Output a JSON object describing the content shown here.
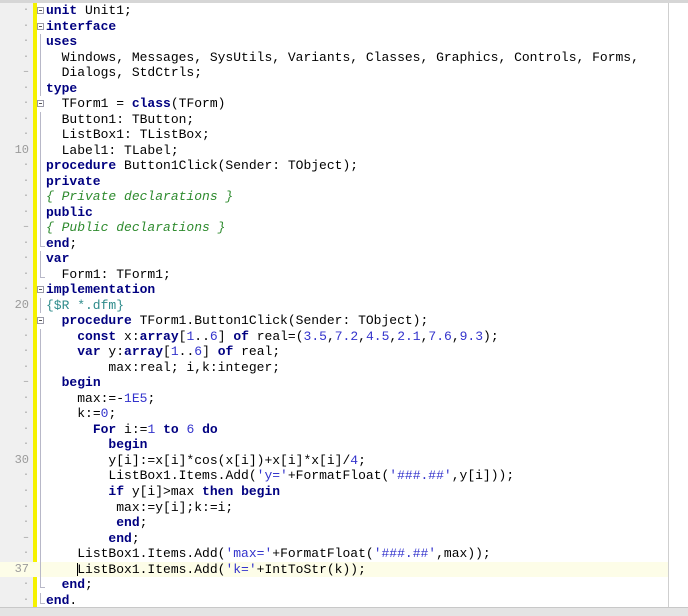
{
  "editor": {
    "colors": {
      "keyword": "#000080",
      "literal": "#3333cc",
      "comment": "#2e8b2e",
      "directive": "#2e8b8b",
      "modified_bar": "#f5f200",
      "current_line": "#fdfde8"
    },
    "current_line": 37,
    "lines": [
      {
        "num": "·",
        "fold": "start",
        "indent": "",
        "tokens": [
          {
            "t": "k",
            "v": "unit"
          },
          {
            "t": "p",
            "v": " Unit1;"
          }
        ]
      },
      {
        "num": "·",
        "fold": "start",
        "indent": "",
        "tokens": [
          {
            "t": "k",
            "v": "interface"
          }
        ]
      },
      {
        "num": "·",
        "fold": "line",
        "indent": "",
        "tokens": [
          {
            "t": "k",
            "v": "uses"
          }
        ]
      },
      {
        "num": "·",
        "fold": "line",
        "indent": "  ",
        "tokens": [
          {
            "t": "p",
            "v": "Windows, Messages, SysUtils, Variants, Classes, Graphics, Controls, Forms,"
          }
        ]
      },
      {
        "num": "–",
        "fold": "line",
        "indent": "  ",
        "tokens": [
          {
            "t": "p",
            "v": "Dialogs, StdCtrls;"
          }
        ]
      },
      {
        "num": "·",
        "fold": "line",
        "indent": "",
        "tokens": [
          {
            "t": "k",
            "v": "type"
          }
        ]
      },
      {
        "num": "·",
        "fold": "start",
        "indent": "  ",
        "tokens": [
          {
            "t": "p",
            "v": "TForm1 = "
          },
          {
            "t": "k",
            "v": "class"
          },
          {
            "t": "p",
            "v": "(TForm)"
          }
        ]
      },
      {
        "num": "·",
        "fold": "line",
        "indent": "  ",
        "tokens": [
          {
            "t": "p",
            "v": "Button1: TButton;"
          }
        ]
      },
      {
        "num": "·",
        "fold": "line",
        "indent": "  ",
        "tokens": [
          {
            "t": "p",
            "v": "ListBox1: TListBox;"
          }
        ]
      },
      {
        "num": "10",
        "fold": "line",
        "indent": "  ",
        "tokens": [
          {
            "t": "p",
            "v": "Label1: TLabel;"
          }
        ]
      },
      {
        "num": "·",
        "fold": "line",
        "indent": "",
        "tokens": [
          {
            "t": "k",
            "v": "procedure"
          },
          {
            "t": "p",
            "v": " Button1Click(Sender: TObject);"
          }
        ]
      },
      {
        "num": "·",
        "fold": "line",
        "indent": "",
        "tokens": [
          {
            "t": "k",
            "v": "private"
          }
        ]
      },
      {
        "num": "·",
        "fold": "line",
        "indent": "",
        "tokens": [
          {
            "t": "c",
            "v": "{ Private declarations }"
          }
        ]
      },
      {
        "num": "·",
        "fold": "line",
        "indent": "",
        "tokens": [
          {
            "t": "k",
            "v": "public"
          }
        ]
      },
      {
        "num": "–",
        "fold": "line",
        "indent": "",
        "tokens": [
          {
            "t": "c",
            "v": "{ Public declarations }"
          }
        ]
      },
      {
        "num": "·",
        "fold": "end",
        "indent": "",
        "tokens": [
          {
            "t": "k",
            "v": "end"
          },
          {
            "t": "p",
            "v": ";"
          }
        ]
      },
      {
        "num": "·",
        "fold": "line",
        "indent": "",
        "tokens": [
          {
            "t": "k",
            "v": "var"
          }
        ]
      },
      {
        "num": "·",
        "fold": "end",
        "indent": "  ",
        "tokens": [
          {
            "t": "p",
            "v": "Form1: TForm1;"
          }
        ]
      },
      {
        "num": "·",
        "fold": "start",
        "indent": "",
        "tokens": [
          {
            "t": "k",
            "v": "implementation"
          }
        ]
      },
      {
        "num": "20",
        "fold": "line",
        "indent": "",
        "tokens": [
          {
            "t": "d",
            "v": "{$R *.dfm}"
          }
        ]
      },
      {
        "num": "·",
        "fold": "start",
        "indent": "  ",
        "tokens": [
          {
            "t": "k",
            "v": "procedure"
          },
          {
            "t": "p",
            "v": " TForm1.Button1Click(Sender: TObject);"
          }
        ]
      },
      {
        "num": "·",
        "fold": "line",
        "indent": "    ",
        "tokens": [
          {
            "t": "k",
            "v": "const"
          },
          {
            "t": "p",
            "v": " x:"
          },
          {
            "t": "k",
            "v": "array"
          },
          {
            "t": "p",
            "v": "["
          },
          {
            "t": "n",
            "v": "1"
          },
          {
            "t": "p",
            "v": ".."
          },
          {
            "t": "n",
            "v": "6"
          },
          {
            "t": "p",
            "v": "] "
          },
          {
            "t": "k",
            "v": "of"
          },
          {
            "t": "p",
            "v": " real=("
          },
          {
            "t": "n",
            "v": "3.5"
          },
          {
            "t": "p",
            "v": ","
          },
          {
            "t": "n",
            "v": "7.2"
          },
          {
            "t": "p",
            "v": ","
          },
          {
            "t": "n",
            "v": "4.5"
          },
          {
            "t": "p",
            "v": ","
          },
          {
            "t": "n",
            "v": "2.1"
          },
          {
            "t": "p",
            "v": ","
          },
          {
            "t": "n",
            "v": "7.6"
          },
          {
            "t": "p",
            "v": ","
          },
          {
            "t": "n",
            "v": "9.3"
          },
          {
            "t": "p",
            "v": ");"
          }
        ]
      },
      {
        "num": "·",
        "fold": "line",
        "indent": "    ",
        "tokens": [
          {
            "t": "k",
            "v": "var"
          },
          {
            "t": "p",
            "v": " y:"
          },
          {
            "t": "k",
            "v": "array"
          },
          {
            "t": "p",
            "v": "["
          },
          {
            "t": "n",
            "v": "1"
          },
          {
            "t": "p",
            "v": ".."
          },
          {
            "t": "n",
            "v": "6"
          },
          {
            "t": "p",
            "v": "] "
          },
          {
            "t": "k",
            "v": "of"
          },
          {
            "t": "p",
            "v": " real;"
          }
        ]
      },
      {
        "num": "·",
        "fold": "line",
        "indent": "        ",
        "tokens": [
          {
            "t": "p",
            "v": "max:real; i,k:integer;"
          }
        ]
      },
      {
        "num": "–",
        "fold": "line",
        "indent": "  ",
        "tokens": [
          {
            "t": "k",
            "v": "begin"
          }
        ]
      },
      {
        "num": "·",
        "fold": "line",
        "indent": "    ",
        "tokens": [
          {
            "t": "p",
            "v": "max:=-"
          },
          {
            "t": "n",
            "v": "1E5"
          },
          {
            "t": "p",
            "v": ";"
          }
        ]
      },
      {
        "num": "·",
        "fold": "line",
        "indent": "    ",
        "tokens": [
          {
            "t": "p",
            "v": "k:="
          },
          {
            "t": "n",
            "v": "0"
          },
          {
            "t": "p",
            "v": ";"
          }
        ]
      },
      {
        "num": "·",
        "fold": "line",
        "indent": "      ",
        "tokens": [
          {
            "t": "k",
            "v": "For"
          },
          {
            "t": "p",
            "v": " i:="
          },
          {
            "t": "n",
            "v": "1"
          },
          {
            "t": "p",
            "v": " "
          },
          {
            "t": "k",
            "v": "to"
          },
          {
            "t": "p",
            "v": " "
          },
          {
            "t": "n",
            "v": "6"
          },
          {
            "t": "p",
            "v": " "
          },
          {
            "t": "k",
            "v": "do"
          }
        ]
      },
      {
        "num": "·",
        "fold": "line",
        "indent": "        ",
        "tokens": [
          {
            "t": "k",
            "v": "begin"
          }
        ]
      },
      {
        "num": "30",
        "fold": "line",
        "indent": "        ",
        "tokens": [
          {
            "t": "p",
            "v": "y[i]:=x[i]*cos(x[i])+x[i]*x[i]/"
          },
          {
            "t": "n",
            "v": "4"
          },
          {
            "t": "p",
            "v": ";"
          }
        ]
      },
      {
        "num": "·",
        "fold": "line",
        "indent": "        ",
        "tokens": [
          {
            "t": "p",
            "v": "ListBox1.Items.Add("
          },
          {
            "t": "n",
            "v": "'y='"
          },
          {
            "t": "p",
            "v": "+FormatFloat("
          },
          {
            "t": "n",
            "v": "'###.##'"
          },
          {
            "t": "p",
            "v": ",y[i]));"
          }
        ]
      },
      {
        "num": "·",
        "fold": "line",
        "indent": "        ",
        "tokens": [
          {
            "t": "k",
            "v": "if"
          },
          {
            "t": "p",
            "v": " y[i]>max "
          },
          {
            "t": "k",
            "v": "then"
          },
          {
            "t": "p",
            "v": " "
          },
          {
            "t": "k",
            "v": "begin"
          }
        ]
      },
      {
        "num": "·",
        "fold": "line",
        "indent": "         ",
        "tokens": [
          {
            "t": "p",
            "v": "max:=y[i];k:=i;"
          }
        ]
      },
      {
        "num": "·",
        "fold": "line",
        "indent": "         ",
        "tokens": [
          {
            "t": "k",
            "v": "end"
          },
          {
            "t": "p",
            "v": ";"
          }
        ]
      },
      {
        "num": "–",
        "fold": "line",
        "indent": "        ",
        "tokens": [
          {
            "t": "k",
            "v": "end"
          },
          {
            "t": "p",
            "v": ";"
          }
        ]
      },
      {
        "num": "·",
        "fold": "line",
        "indent": "    ",
        "tokens": [
          {
            "t": "p",
            "v": "ListBox1.Items.Add("
          },
          {
            "t": "n",
            "v": "'max='"
          },
          {
            "t": "p",
            "v": "+FormatFloat("
          },
          {
            "t": "n",
            "v": "'###.##'"
          },
          {
            "t": "p",
            "v": ",max));"
          }
        ]
      },
      {
        "num": "37",
        "fold": "line",
        "indent": "    ",
        "tokens": [
          {
            "t": "p",
            "v": "ListBox1.Items.Add("
          },
          {
            "t": "n",
            "v": "'k='"
          },
          {
            "t": "p",
            "v": "+IntToStr(k));"
          }
        ]
      },
      {
        "num": "·",
        "fold": "end",
        "indent": "  ",
        "tokens": [
          {
            "t": "k",
            "v": "end"
          },
          {
            "t": "p",
            "v": ";"
          }
        ]
      },
      {
        "num": "·",
        "fold": "end",
        "indent": "",
        "tokens": [
          {
            "t": "k",
            "v": "end"
          },
          {
            "t": "p",
            "v": "."
          }
        ]
      }
    ]
  }
}
